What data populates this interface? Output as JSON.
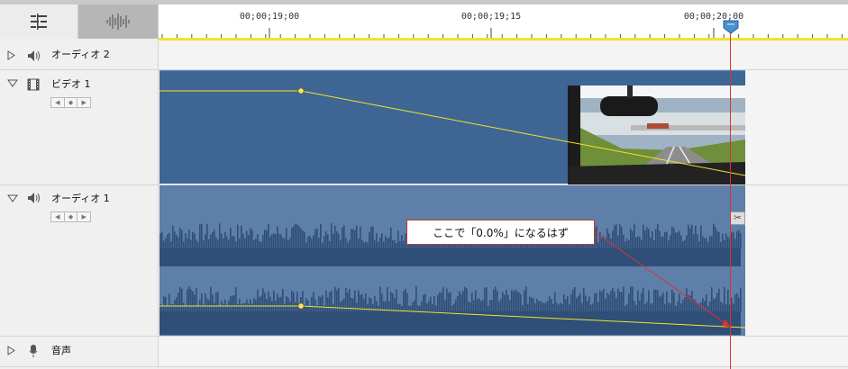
{
  "ruler": {
    "timecodes": [
      "00;00;19;00",
      "00;00;19;15",
      "00;00;20;00"
    ]
  },
  "tracks": {
    "audio2": {
      "label": "オーディオ 2",
      "icon": "speaker-icon"
    },
    "video1": {
      "label": "ビデオ 1",
      "icon": "film-icon",
      "nav": [
        "◀",
        "◆",
        "▶"
      ]
    },
    "audio1": {
      "label": "オーディオ 1",
      "icon": "speaker-icon",
      "nav": [
        "◀",
        "◆",
        "▶"
      ]
    },
    "voice": {
      "label": "音声",
      "icon": "microphone-icon"
    }
  },
  "annotation": {
    "text": "ここで「0.0%」になるはず"
  },
  "colors": {
    "video_clip": "#3d6694",
    "audio_clip": "#5e7fa9",
    "waveform": "#2f4f78",
    "keyframe_line": "#f2e42a",
    "playhead": "#e03030",
    "annotation_border": "#c0392b"
  }
}
